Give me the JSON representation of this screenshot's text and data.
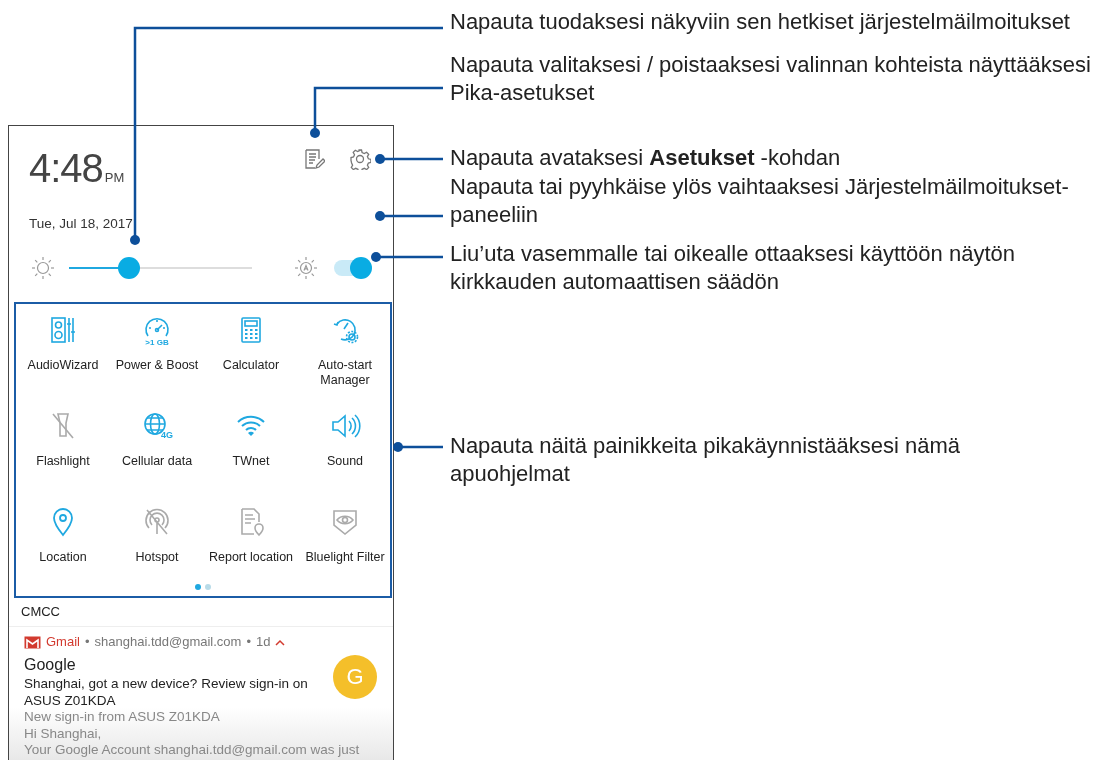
{
  "phone": {
    "clock": {
      "time": "4:48",
      "ampm": "PM"
    },
    "date": "Tue, Jul 18, 2017",
    "brightness": {
      "level": 0.33,
      "auto": true
    },
    "quick_settings": [
      {
        "label": "AudioWizard",
        "on": true
      },
      {
        "label": "Power & Boost",
        "on": true,
        "sublabel": ">1 GB"
      },
      {
        "label": "Calculator",
        "on": true
      },
      {
        "label": "Auto-start Manager",
        "on": true
      },
      {
        "label": "Flashlight",
        "on": false
      },
      {
        "label": "Cellular data",
        "on": true,
        "sublabel": "4G"
      },
      {
        "label": "TWnet",
        "on": true
      },
      {
        "label": "Sound",
        "on": true
      },
      {
        "label": "Location",
        "on": true
      },
      {
        "label": "Hotspot",
        "on": false
      },
      {
        "label": "Report location",
        "on": false
      },
      {
        "label": "Bluelight Filter",
        "on": false
      }
    ],
    "pages": [
      {
        "selected": true
      },
      {
        "selected": false
      }
    ],
    "carrier": "CMCC",
    "notification": {
      "app": "Gmail",
      "separator_1": "•",
      "account": "shanghai.tdd@gmail.com",
      "separator_2": "•",
      "time": "1d",
      "expanded": true,
      "avatar": "G",
      "title": "Google",
      "lines": [
        {
          "text": "Shanghai, got a new device? Review sign-in on ASUS Z01KDA",
          "muted": false
        },
        {
          "text": "New sign-in from ASUS Z01KDA",
          "muted": true
        },
        {
          "text": "Hi Shanghai,",
          "muted": true
        },
        {
          "text": "Your Google Account shanghai.tdd@gmail.com was just",
          "muted": true
        }
      ]
    }
  },
  "callouts": [
    {
      "lines": [
        "Napauta tuodaksesi näkyviin sen hetkiset järjestelmäilmoitukset"
      ]
    },
    {
      "lines": [
        "Napauta valitaksesi / poistaaksesi valinnan kohteista näyttääksesi",
        "Pika-asetukset"
      ]
    },
    {
      "lines": [
        "Napauta avataksesi **Asetukset** -kohdan"
      ]
    },
    {
      "lines": [
        "Napauta tai pyyhkäise ylös vaihtaaksesi Järjestelmäilmoitukset-",
        "paneeliin"
      ]
    },
    {
      "lines": [
        "Liu’uta vasemmalle tai oikealle ottaaksesi käyttöön näytön",
        "kirkkauden automaattisen säädön"
      ]
    },
    {
      "lines": [
        "Napauta näitä painikkeita pikakäynnistääksesi nämä",
        "apuohjelmat"
      ]
    }
  ]
}
